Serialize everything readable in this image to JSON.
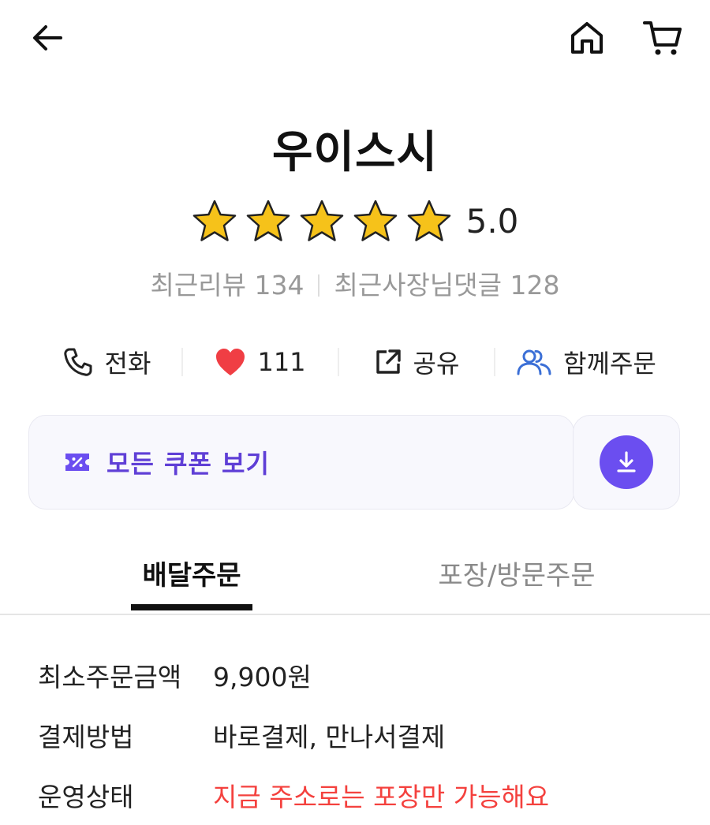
{
  "header": {
    "icons": [
      "back-arrow-icon",
      "home-icon",
      "cart-icon"
    ]
  },
  "store": {
    "name": "우이스시",
    "rating": {
      "stars": 5,
      "score": "5.0",
      "star_color": "#F6C21A"
    },
    "recent_reviews_label": "최근리뷰 134",
    "recent_owner_replies_label": "최근사장님댓글 128"
  },
  "actions": {
    "call_label": "전화",
    "like_count": "111",
    "share_label": "공유",
    "group_order_label": "함께주문"
  },
  "coupon": {
    "label": "모든 쿠폰 보기",
    "accent_color": "#6B4EF0"
  },
  "tabs": {
    "delivery": "배달주문",
    "pickup": "포장/방문주문",
    "active": "배달주문"
  },
  "info": {
    "min_order": {
      "label": "최소주문금액",
      "value": "9,900원"
    },
    "payment": {
      "label": "결제방법",
      "value": "바로결제, 만나서결제"
    },
    "status": {
      "label": "운영상태",
      "value": "지금 주소로는 포장만 가능해요",
      "color": "#F4413E"
    }
  }
}
